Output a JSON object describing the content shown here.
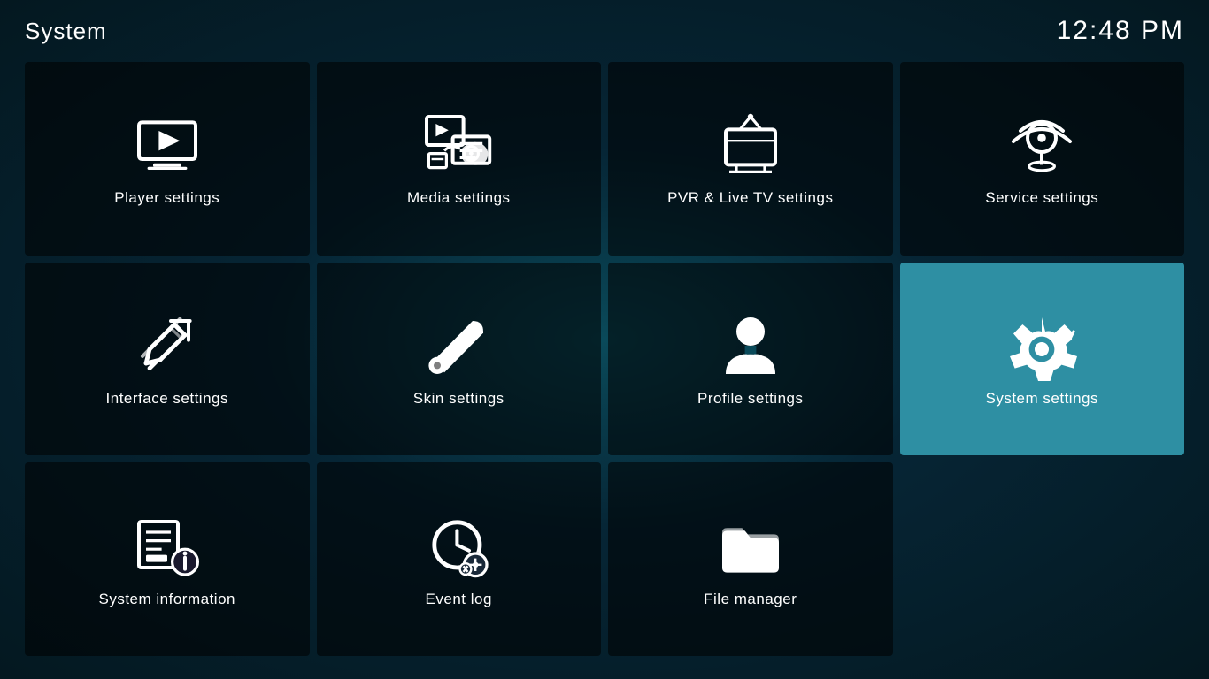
{
  "header": {
    "title": "System",
    "clock": "12:48 PM"
  },
  "tiles": [
    {
      "id": "player-settings",
      "label": "Player settings",
      "icon": "player",
      "active": false
    },
    {
      "id": "media-settings",
      "label": "Media settings",
      "icon": "media",
      "active": false
    },
    {
      "id": "pvr-settings",
      "label": "PVR & Live TV settings",
      "icon": "pvr",
      "active": false
    },
    {
      "id": "service-settings",
      "label": "Service settings",
      "icon": "service",
      "active": false
    },
    {
      "id": "interface-settings",
      "label": "Interface settings",
      "icon": "interface",
      "active": false
    },
    {
      "id": "skin-settings",
      "label": "Skin settings",
      "icon": "skin",
      "active": false
    },
    {
      "id": "profile-settings",
      "label": "Profile settings",
      "icon": "profile",
      "active": false
    },
    {
      "id": "system-settings",
      "label": "System settings",
      "icon": "system",
      "active": true
    },
    {
      "id": "system-information",
      "label": "System information",
      "icon": "information",
      "active": false
    },
    {
      "id": "event-log",
      "label": "Event log",
      "icon": "eventlog",
      "active": false
    },
    {
      "id": "file-manager",
      "label": "File manager",
      "icon": "filemanager",
      "active": false
    }
  ]
}
